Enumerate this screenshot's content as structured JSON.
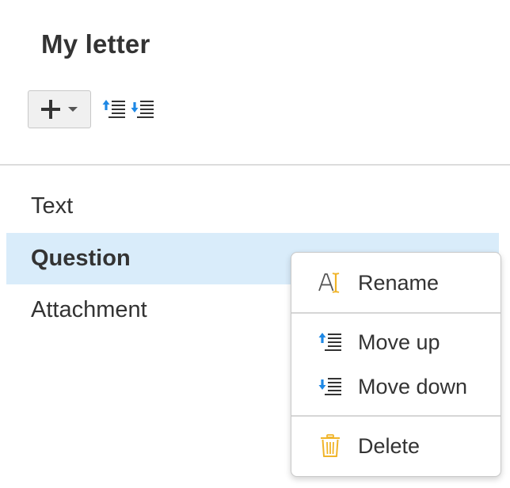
{
  "document": {
    "title": "My letter"
  },
  "toolbar": {
    "add_icon": "plus-icon",
    "dropdown_icon": "caret-down-icon",
    "move_up_icon": "move-up-icon",
    "move_down_icon": "move-down-icon"
  },
  "items": [
    {
      "label": "Text",
      "selected": false
    },
    {
      "label": "Question",
      "selected": true
    },
    {
      "label": "Attachment",
      "selected": false
    }
  ],
  "context_menu": {
    "rename": {
      "label": "Rename",
      "icon": "rename-icon"
    },
    "move_up": {
      "label": "Move up",
      "icon": "move-up-icon"
    },
    "move_down": {
      "label": "Move down",
      "icon": "move-down-icon"
    },
    "delete": {
      "label": "Delete",
      "icon": "trash-icon"
    }
  },
  "colors": {
    "text": "#333333",
    "selection_bg": "#d9ecfa",
    "arrow_blue": "#1e88e5",
    "accent_yellow": "#f0b429",
    "divider": "#dcdcdc"
  }
}
